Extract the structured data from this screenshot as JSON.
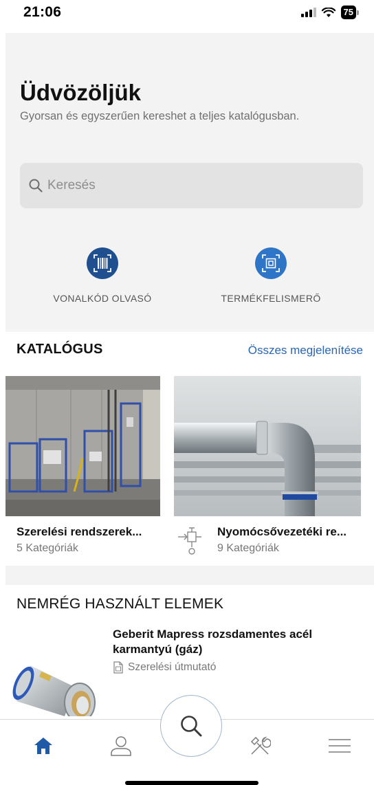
{
  "status": {
    "time": "21:06",
    "battery": "75"
  },
  "hero": {
    "title": "Üdvözöljük",
    "subtitle": "Gyorsan és egyszerűen kereshet a teljes katalógusban.",
    "search_placeholder": "Keresés",
    "actions": [
      {
        "label": "VONALKÓD OLVASÓ",
        "icon": "barcode-scanner-icon"
      },
      {
        "label": "TERMÉKFELISMERŐ",
        "icon": "product-recognition-icon"
      }
    ]
  },
  "catalog": {
    "title": "KATALÓGUS",
    "show_all": "Összes megjelenítése",
    "cards": [
      {
        "title": "Szerelési rendszerek...",
        "subtitle": "5 Kategóriák"
      },
      {
        "title": "Nyomócsővezetéki re...",
        "subtitle": "9 Kategóriák"
      }
    ]
  },
  "recent": {
    "title": "NEMRÉG HASZNÁLT ELEMEK",
    "items": [
      {
        "title": "Geberit Mapress rozsdamentes acél karmantyú (gáz)",
        "doc": "Szerelési útmutató"
      }
    ]
  },
  "tab_bar": {
    "items": [
      "home-icon",
      "profile-icon",
      "search-icon",
      "tools-icon",
      "menu-icon"
    ],
    "active": "home-icon"
  },
  "colors": {
    "accent": "#1f4f8f",
    "link": "#2a66b3",
    "hero_bg": "#f3f3f3"
  }
}
